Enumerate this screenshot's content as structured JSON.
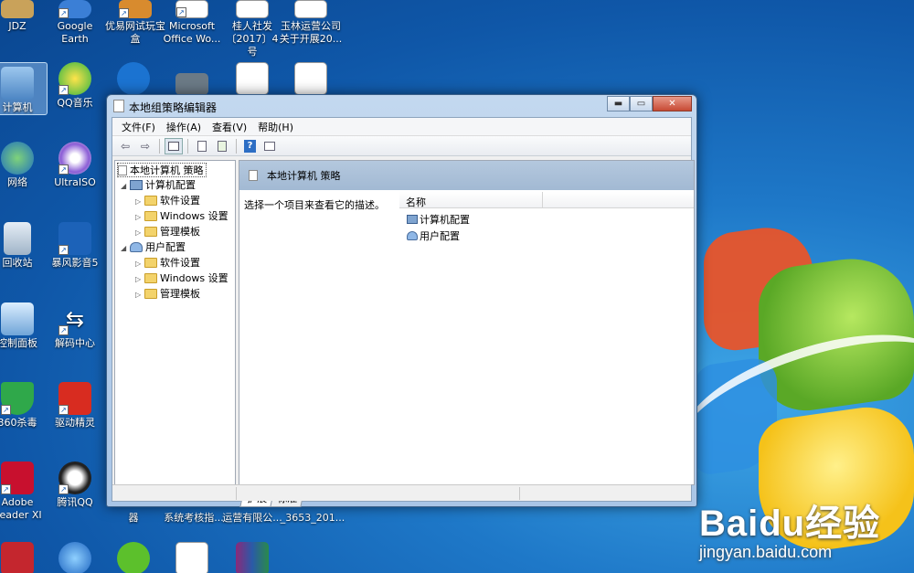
{
  "desktop": {
    "icons": [
      {
        "label": "JDZ"
      },
      {
        "label": "Google Earth"
      },
      {
        "label": "优易网试玩宝盒"
      },
      {
        "label": "Microsoft Office Wo..."
      },
      {
        "label": "桂人社发〔2017〕4号"
      },
      {
        "label": "玉林运营公司关于开展20..."
      },
      {
        "label": "计算机"
      },
      {
        "label": "QQ音乐"
      },
      {
        "label": "网络"
      },
      {
        "label": "UltraISO"
      },
      {
        "label": "回收站"
      },
      {
        "label": "暴风影音5"
      },
      {
        "label": "控制面板"
      },
      {
        "label": "解码中心"
      },
      {
        "label": "360杀毒"
      },
      {
        "label": "驱动精灵"
      },
      {
        "label": "Adobe Reader XI"
      },
      {
        "label": "腾讯QQ"
      },
      {
        "label": "器"
      },
      {
        "label": "系统考核指..."
      },
      {
        "label": "运营有限公..."
      },
      {
        "label": "_3653_201..."
      }
    ]
  },
  "watermark": {
    "brand": "Baidu经验",
    "url": "jingyan.baidu.com"
  },
  "window": {
    "title": "本地组策略编辑器",
    "controls": {
      "minimize": "▬",
      "maximize": "▭",
      "close": "✕"
    },
    "menu": [
      "文件(F)",
      "操作(A)",
      "查看(V)",
      "帮助(H)"
    ],
    "toolbar": {
      "back": "⇦",
      "forward": "⇨",
      "help": "?"
    },
    "tree": {
      "root": "本地计算机 策略",
      "computer_config": "计算机配置",
      "computer_children": [
        "软件设置",
        "Windows 设置",
        "管理模板"
      ],
      "user_config": "用户配置",
      "user_children": [
        "软件设置",
        "Windows 设置",
        "管理模板"
      ]
    },
    "right_pane": {
      "header": "本地计算机 策略",
      "description": "选择一个项目来查看它的描述。",
      "column_name": "名称",
      "items": [
        "计算机配置",
        "用户配置"
      ]
    },
    "tabs": [
      "扩展",
      "标准"
    ]
  }
}
